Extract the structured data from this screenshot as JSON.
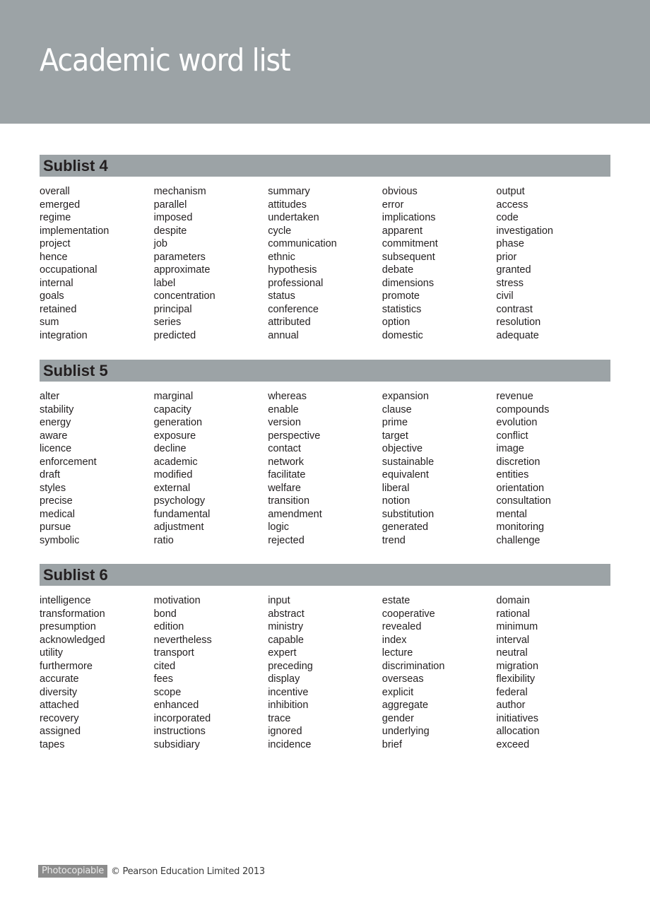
{
  "header": {
    "title": "Academic word list"
  },
  "sublists": [
    {
      "title": "Sublist 4",
      "columns": [
        [
          "overall",
          "emerged",
          "regime",
          "implementation",
          "project",
          "hence",
          "occupational",
          "internal",
          "goals",
          "retained",
          "sum",
          "integration"
        ],
        [
          "mechanism",
          "parallel",
          "imposed",
          "despite",
          "job",
          "parameters",
          "approximate",
          "label",
          "concentration",
          "principal",
          "series",
          "predicted"
        ],
        [
          "summary",
          "attitudes",
          "undertaken",
          "cycle",
          "communication",
          "ethnic",
          "hypothesis",
          "professional",
          "status",
          "conference",
          "attributed",
          "annual"
        ],
        [
          "obvious",
          "error",
          "implications",
          "apparent",
          "commitment",
          "subsequent",
          "debate",
          "dimensions",
          "promote",
          "statistics",
          "option",
          "domestic"
        ],
        [
          "output",
          "access",
          "code",
          "investigation",
          "phase",
          "prior",
          "granted",
          "stress",
          "civil",
          "contrast",
          "resolution",
          "adequate"
        ]
      ]
    },
    {
      "title": "Sublist 5",
      "columns": [
        [
          "alter",
          "stability",
          "energy",
          "aware",
          "licence",
          "enforcement",
          "draft",
          "styles",
          "precise",
          "medical",
          "pursue",
          "symbolic"
        ],
        [
          "marginal",
          "capacity",
          "generation",
          "exposure",
          "decline",
          "academic",
          "modified",
          "external",
          "psychology",
          "fundamental",
          "adjustment",
          "ratio"
        ],
        [
          "whereas",
          "enable",
          "version",
          "perspective",
          "contact",
          "network",
          "facilitate",
          "welfare",
          "transition",
          "amendment",
          "logic",
          "rejected"
        ],
        [
          "expansion",
          "clause",
          "prime",
          "target",
          "objective",
          "sustainable",
          "equivalent",
          "liberal",
          "notion",
          "substitution",
          "generated",
          "trend"
        ],
        [
          "revenue",
          "compounds",
          "evolution",
          "conflict",
          "image",
          "discretion",
          "entities",
          "orientation",
          "consultation",
          "mental",
          "monitoring",
          "challenge"
        ]
      ]
    },
    {
      "title": "Sublist 6",
      "columns": [
        [
          "intelligence",
          "transformation",
          "presumption",
          "acknowledged",
          "utility",
          "furthermore",
          "accurate",
          "diversity",
          "attached",
          "recovery",
          "assigned",
          "tapes"
        ],
        [
          "motivation",
          "bond",
          "edition",
          "nevertheless",
          "transport",
          "cited",
          "fees",
          "scope",
          "enhanced",
          "incorporated",
          "instructions",
          "subsidiary"
        ],
        [
          "input",
          "abstract",
          "ministry",
          "capable",
          "expert",
          "preceding",
          "display",
          "incentive",
          "inhibition",
          "trace",
          "ignored",
          "incidence"
        ],
        [
          "estate",
          "cooperative",
          "revealed",
          "index",
          "lecture",
          "discrimination",
          "overseas",
          "explicit",
          "aggregate",
          "gender",
          "underlying",
          "brief"
        ],
        [
          "domain",
          "rational",
          "minimum",
          "interval",
          "neutral",
          "migration",
          "flexibility",
          "federal",
          "author",
          "initiatives",
          "allocation",
          "exceed"
        ]
      ]
    }
  ],
  "footer": {
    "badge": "Photocopiable",
    "copyright": "© Pearson Education Limited 2013"
  },
  "colors": {
    "banner": "#9ca3a6",
    "header_bar": "#9ca3a6",
    "text": "#231f20",
    "badge": "#8c8c8c"
  }
}
